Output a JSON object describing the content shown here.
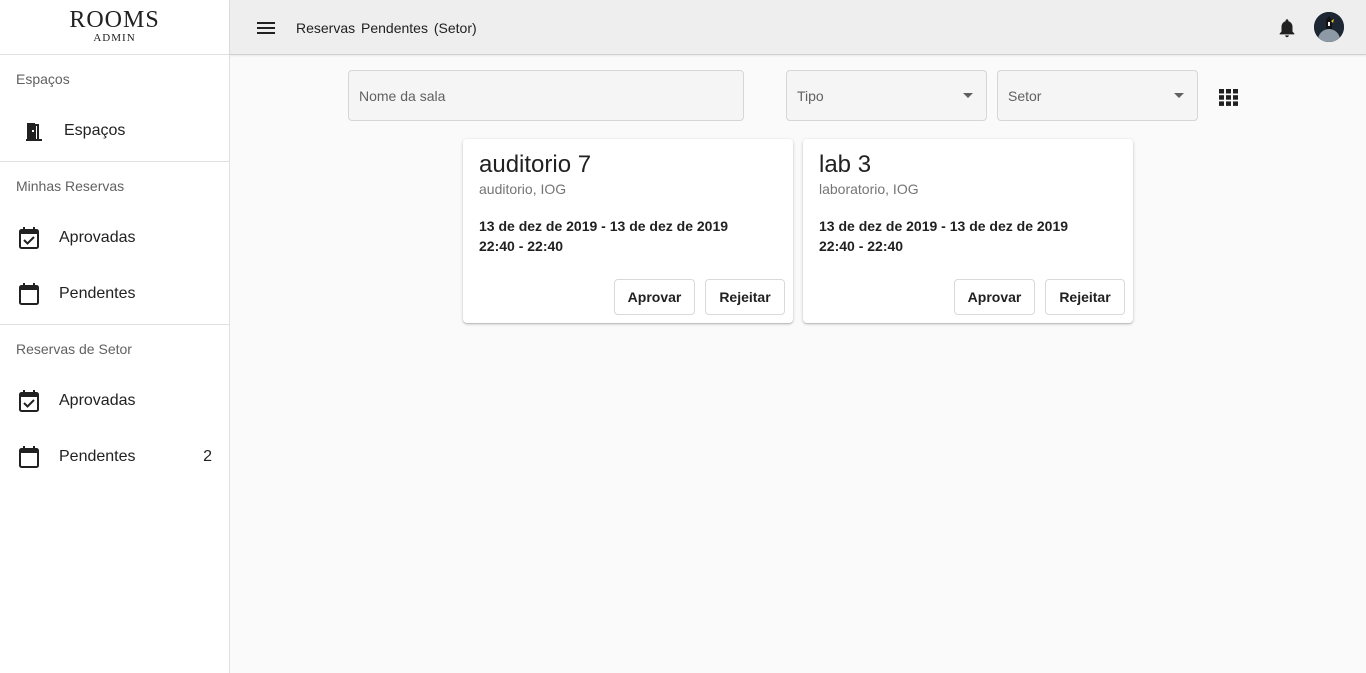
{
  "logo": {
    "title": "ROOMS",
    "subtitle": "ADMIN"
  },
  "sidebar": {
    "sections": [
      {
        "header": "Espaços",
        "items": [
          {
            "label": "Espaços",
            "icon": "door-icon"
          }
        ]
      },
      {
        "header": "Minhas Reservas",
        "items": [
          {
            "label": "Aprovadas",
            "icon": "calendar-check-icon"
          },
          {
            "label": "Pendentes",
            "icon": "calendar-icon"
          }
        ]
      },
      {
        "header": "Reservas de Setor",
        "items": [
          {
            "label": "Aprovadas",
            "icon": "calendar-check-icon"
          },
          {
            "label": "Pendentes",
            "icon": "calendar-icon",
            "badge": "2"
          }
        ]
      }
    ]
  },
  "header": {
    "title": "Reservas Pendentes (Setor)",
    "icons": [
      "menu-icon",
      "bell-icon",
      "avatar"
    ]
  },
  "filters": {
    "room_name_placeholder": "Nome da sala",
    "type_label": "Tipo",
    "sector_label": "Setor",
    "view_icon": "grid-view-icon"
  },
  "cards": [
    {
      "title": "auditorio 7",
      "subtitle": "auditorio, IOG",
      "dates": "13 de dez de 2019 - 13 de dez de 2019",
      "times": "22:40 - 22:40",
      "approve": "Aprovar",
      "reject": "Rejeitar"
    },
    {
      "title": "lab 3",
      "subtitle": "laboratorio, IOG",
      "dates": "13 de dez de 2019 - 13 de dez de 2019",
      "times": "22:40 - 22:40",
      "approve": "Aprovar",
      "reject": "Rejeitar"
    }
  ],
  "colors": {
    "topbar_bg": "#eeeeee",
    "page_bg": "#fafafa",
    "text": "#212121",
    "muted": "#757575"
  }
}
